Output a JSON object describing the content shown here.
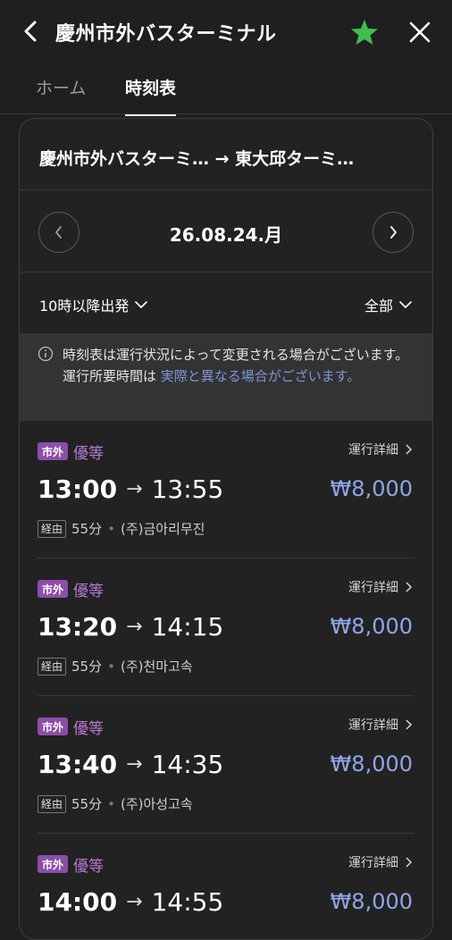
{
  "header": {
    "title": "慶州市外バスターミナル"
  },
  "tabs": [
    {
      "label": "ホーム"
    },
    {
      "label": "時刻表"
    }
  ],
  "route": {
    "text": "慶州市外バスターミ…  → 東大邱ターミ…"
  },
  "date": {
    "label": "26.08.24.月"
  },
  "filters": {
    "time": "10時以降出発",
    "type": "全部"
  },
  "notice": {
    "text_plain": "時刻表は運行状況によって変更される場合がございます。運行所要時間は ",
    "text_highlight": "実際と異なる場合がございます。"
  },
  "buses": [
    {
      "badge": "市外",
      "grade": "優等",
      "detail": "運行詳細",
      "depart": "13:00",
      "arrive": "13:55",
      "price": "₩8,000",
      "via": "経由",
      "duration": "55分",
      "company": "(주)금아리무진"
    },
    {
      "badge": "市外",
      "grade": "優等",
      "detail": "運行詳細",
      "depart": "13:20",
      "arrive": "14:15",
      "price": "₩8,000",
      "via": "経由",
      "duration": "55分",
      "company": "(주)천마고속"
    },
    {
      "badge": "市外",
      "grade": "優等",
      "detail": "運行詳細",
      "depart": "13:40",
      "arrive": "14:35",
      "price": "₩8,000",
      "via": "経由",
      "duration": "55分",
      "company": "(주)아성고속"
    },
    {
      "badge": "市外",
      "grade": "優等",
      "detail": "運行詳細",
      "depart": "14:00",
      "arrive": "14:55",
      "price": "₩8,000"
    }
  ],
  "colors": {
    "background": "#1f1f1f",
    "star": "#3fbf4f",
    "badge": "#8d4ea8",
    "grade": "#b779d6",
    "price": "#8fa6e8",
    "link": "#7b96d9"
  }
}
